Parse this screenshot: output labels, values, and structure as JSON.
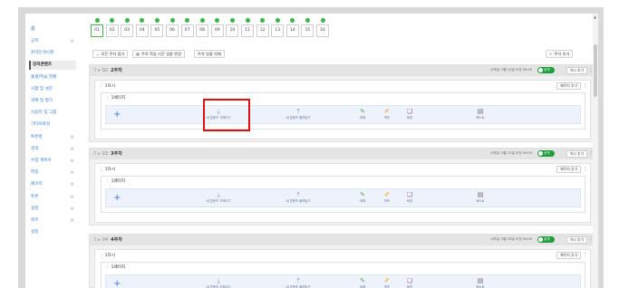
{
  "sidebar": {
    "home": "홈",
    "items": [
      {
        "label": "공지",
        "gear": true
      },
      {
        "label": "온라인게시판",
        "gear": false
      },
      {
        "label": "강의콘텐츠",
        "gear": false,
        "active": true
      },
      {
        "label": "출결/학습 현황",
        "gear": false
      },
      {
        "label": "시험 및 설문",
        "gear": false
      },
      {
        "label": "과제 및 평가",
        "gear": false
      },
      {
        "label": "사용자 및 그룹",
        "gear": false
      },
      {
        "label": "기타자료실",
        "gear": false
      },
      {
        "label": "토론방",
        "gear": true
      },
      {
        "label": "성과",
        "gear": true
      },
      {
        "label": "수업 계획서",
        "gear": true
      },
      {
        "label": "파일",
        "gear": true
      },
      {
        "label": "페이지",
        "gear": true
      },
      {
        "label": "토론",
        "gear": true
      },
      {
        "label": "설정",
        "gear": true
      },
      {
        "label": "퀴즈",
        "gear": true
      },
      {
        "label": "설정",
        "gear": false
      }
    ]
  },
  "weeks": [
    "01",
    "02",
    "03",
    "04",
    "05",
    "06",
    "07",
    "08",
    "09",
    "10",
    "11",
    "12",
    "13",
    "14",
    "15",
    "16"
  ],
  "toolbar": {
    "collapse_label": "모든 주차 접기",
    "period_label": "주차 학습 기간 일괄 변경",
    "delete_label": "주차 일괄 삭제",
    "add_week_label": "주차 추가"
  },
  "sections": [
    {
      "num": "02",
      "title": "2주차",
      "period": "시작일: 3월 14일 오전 00:00",
      "toggle": "공개",
      "add_class": "차시 추가",
      "class_title": "1차시",
      "add_page": "페이지 추가",
      "page_title": "1페이지"
    },
    {
      "num": "03",
      "title": "3주차",
      "period": "시작일: 3월 21일 오전 00:00",
      "toggle": "공개",
      "add_class": "차시 추가",
      "class_title": "1차시",
      "add_page": "페이지 추가",
      "page_title": "1페이지"
    },
    {
      "num": "04",
      "title": "4주차",
      "period": "시작일: 3월 28일 오전 00:00",
      "toggle": "공개",
      "add_class": "차시 추가",
      "class_title": "1차시",
      "add_page": "페이지 추가",
      "page_title": "1페이지"
    }
  ],
  "tools": [
    {
      "icon": "download-icon",
      "glyph": "⤓",
      "label": "내 콘텐츠 가져오기",
      "color": "#8a97a8"
    },
    {
      "icon": "upload-icon",
      "glyph": "⤒",
      "label": "내 콘텐츠 올려놓기",
      "color": "#8a97a8"
    },
    {
      "icon": "task-icon",
      "glyph": "✎",
      "label": "과제",
      "color": "#4caf50"
    },
    {
      "icon": "quiz-icon",
      "glyph": "✐",
      "label": "퀴즈",
      "color": "#f39c12"
    },
    {
      "icon": "discussion-icon",
      "glyph": "❏",
      "label": "토론",
      "color": "#9b59b6"
    },
    {
      "icon": "text-icon",
      "glyph": "▤",
      "label": "텍스트",
      "color": "#6b6b6b"
    }
  ],
  "colors": {
    "accent": "#3a7bd5",
    "toggle_on": "#1e9e3a",
    "week_dot": "#39b54a",
    "highlight": "#e01010"
  }
}
